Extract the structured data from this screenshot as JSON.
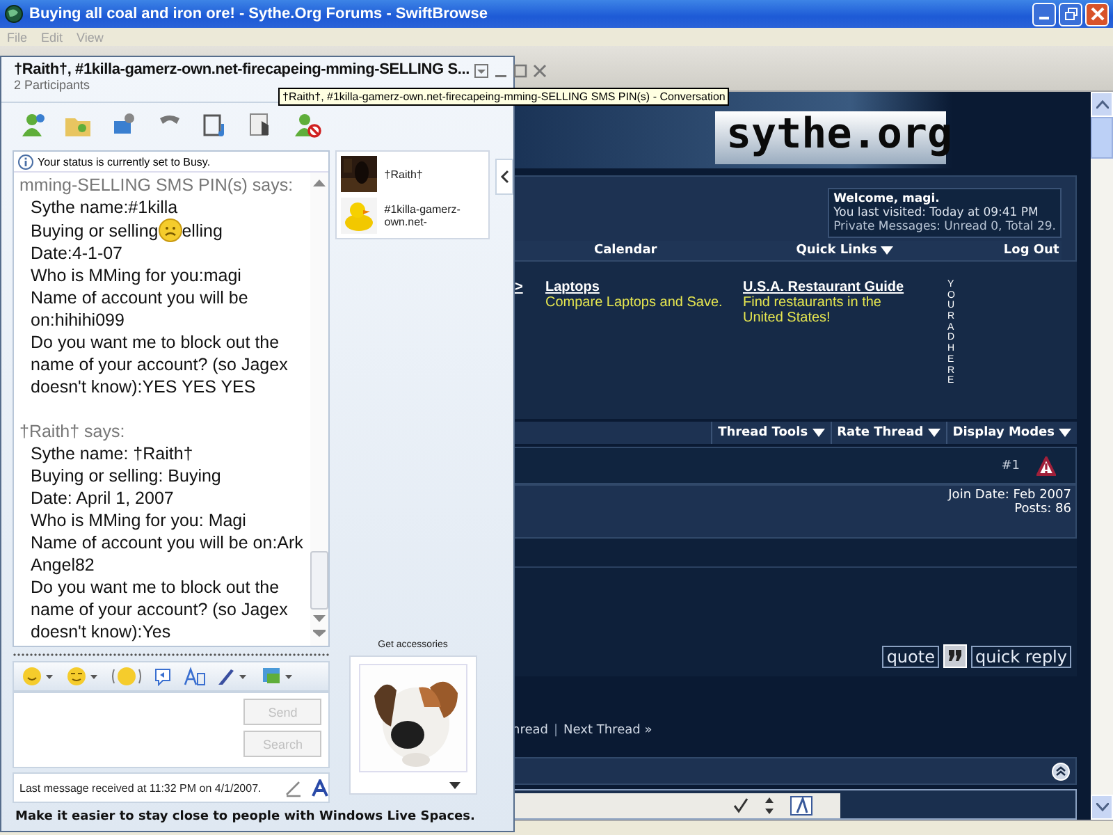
{
  "browser": {
    "title": "Buying all coal and iron ore! - Sythe.Org Forums - SwiftBrowse",
    "menu": [
      "File",
      "Edit",
      "View"
    ]
  },
  "forum": {
    "logo": "sythe.org",
    "welcome": {
      "greeting": "Welcome, magi.",
      "last_visited": "You last visited: Today at 09:41 PM",
      "messages": "Private Messages: Unread 0, Total 29."
    },
    "nav": [
      {
        "label": "Calendar",
        "dropdown": false
      },
      {
        "label": "Quick Links",
        "dropdown": true
      },
      {
        "label": "Log Out",
        "dropdown": false
      }
    ],
    "ads": {
      "arrow": ">",
      "items": [
        {
          "title": "Laptops",
          "text": "Compare Laptops and Save."
        },
        {
          "title": "U.S.A. Restaurant Guide",
          "text": "Find restaurants in the United States!"
        }
      ],
      "vertical": "YOUR AD HERE"
    },
    "thread_tools": [
      {
        "label": "Thread Tools"
      },
      {
        "label": "Rate Thread"
      },
      {
        "label": "Display Modes"
      }
    ],
    "post": {
      "number": "#1",
      "join_date": "Join Date: Feb 2007",
      "posts": "Posts: 86",
      "buttons": [
        "quote",
        "quick reply"
      ]
    },
    "thread_nav": {
      "previous": "hread",
      "separator": "|",
      "next": "Next Thread »"
    }
  },
  "chat": {
    "title": "†Raith†, #1killa-gamerz-own.net-firecapeing-mming-SELLING S...",
    "participants": "2 Participants",
    "status": "Your status is currently set to Busy.",
    "messages": [
      {
        "sender": "mming-SELLING SMS PIN(s) says:",
        "lines": [
          {
            "kind": "text",
            "text": "Sythe name:#1killa"
          },
          {
            "kind": "emoticon",
            "text": "Buying or selling",
            "text_after": "elling"
          },
          {
            "kind": "text",
            "text": "Date:4-1-07"
          },
          {
            "kind": "text",
            "text": "Who is MMing for you:magi"
          },
          {
            "kind": "text",
            "text": "Name of account you will be on:hihihi099"
          },
          {
            "kind": "text",
            "text": "Do you want me to block out the name of your account? (so Jagex doesn't know):YES YES YES"
          }
        ]
      },
      {
        "sender": "†Raith† says:",
        "lines": [
          {
            "kind": "text",
            "text": "Sythe name: †Raith†"
          },
          {
            "kind": "text",
            "text": "Buying or selling: Buying"
          },
          {
            "kind": "text",
            "text": "Date: April 1, 2007"
          },
          {
            "kind": "text",
            "text": "Who is MMing for you: Magi"
          },
          {
            "kind": "text",
            "text": "Name of account you will be on:Ark Angel82"
          },
          {
            "kind": "text",
            "text": "Do you want me to block out the name of your account? (so Jagex doesn't know):Yes"
          }
        ]
      }
    ],
    "contacts": [
      {
        "name": "†Raith†"
      },
      {
        "name": "#1killa-gamerz-own.net-"
      }
    ],
    "accessories": "Get accessories",
    "buttons": [
      {
        "label": "Send",
        "disabled": true
      },
      {
        "label": "Search",
        "disabled": true
      }
    ],
    "last_message": "Last message received at 11:32 PM on 4/1/2007.",
    "promo": "Make it easier to stay close to people with Windows Live Spaces."
  },
  "tooltip": "†Raith†, #1killa-gamerz-own.net-firecapeing-mming-SELLING SMS PIN(s) - Conversation"
}
